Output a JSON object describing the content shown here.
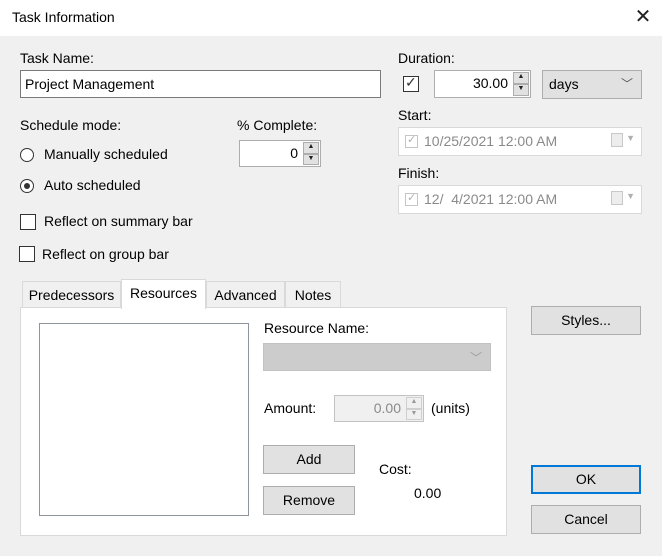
{
  "window": {
    "title": "Task Information",
    "close_icon": "✕"
  },
  "task_name": {
    "label": "Task Name:",
    "value": "Project Management"
  },
  "duration": {
    "label": "Duration:",
    "estimated_checked": true,
    "value": "30.00",
    "unit": "days"
  },
  "start": {
    "label": "Start:",
    "value": "10/25/2021 12:00 AM",
    "checked": true
  },
  "finish": {
    "label": "Finish:",
    "value": "12/  4/2021 12:00 AM",
    "checked": true
  },
  "schedule_mode": {
    "label": "Schedule mode:",
    "options": [
      {
        "label": "Manually scheduled",
        "selected": false
      },
      {
        "label": "Auto scheduled",
        "selected": true
      }
    ]
  },
  "percent_complete": {
    "label": "% Complete:",
    "value": "0"
  },
  "checkboxes": [
    {
      "label": "Reflect on summary bar",
      "checked": false
    },
    {
      "label": "Reflect on group bar",
      "checked": false
    }
  ],
  "tabs": [
    {
      "label": "Predecessors",
      "active": false
    },
    {
      "label": "Resources",
      "active": true
    },
    {
      "label": "Advanced",
      "active": false
    },
    {
      "label": "Notes",
      "active": false
    }
  ],
  "resources": {
    "resource_name_label": "Resource Name:",
    "resource_name_value": "",
    "amount_label": "Amount:",
    "amount_value": "0.00",
    "amount_unit": "(units)",
    "add_label": "Add",
    "remove_label": "Remove",
    "cost_label": "Cost:",
    "cost_value": "0.00",
    "list_items": []
  },
  "buttons": {
    "styles": "Styles...",
    "ok": "OK",
    "cancel": "Cancel"
  },
  "colors": {
    "accent": "#0078d7",
    "background": "#f0f0f0"
  }
}
